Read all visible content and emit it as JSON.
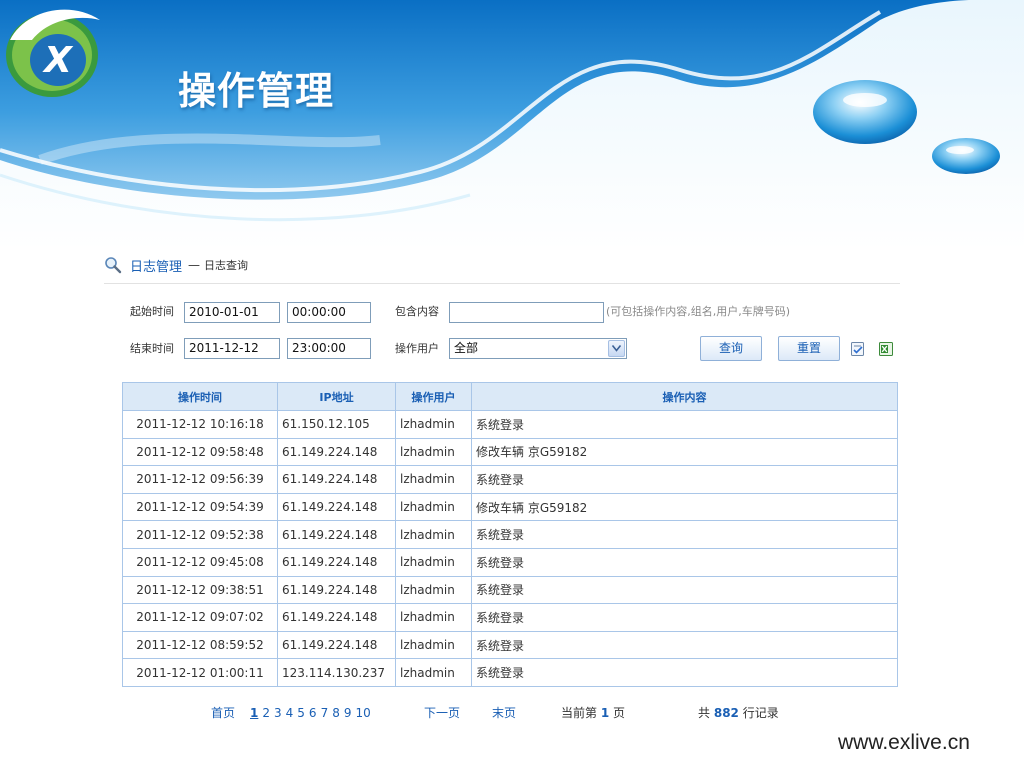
{
  "banner": {
    "title": "操作管理"
  },
  "breadcrumb": {
    "main": "日志管理",
    "separator": "—",
    "sub": "日志查询"
  },
  "filters": {
    "start_label": "起始时间",
    "start_date": "2010-01-01",
    "start_time": "00:00:00",
    "end_label": "结束时间",
    "end_date": "2011-12-12",
    "end_time": "23:00:00",
    "content_label": "包含内容",
    "content_value": "",
    "content_hint": "(可包括操作内容,组名,用户,车牌号码)",
    "user_label": "操作用户",
    "user_selected": "全部",
    "query_button": "查询",
    "reset_button": "重置"
  },
  "table": {
    "columns": [
      "操作时间",
      "IP地址",
      "操作用户",
      "操作内容"
    ],
    "rows": [
      [
        "2011-12-12 10:16:18",
        "61.150.12.105",
        "lzhadmin",
        "系统登录"
      ],
      [
        "2011-12-12 09:58:48",
        "61.149.224.148",
        "lzhadmin",
        "修改车辆 京G59182"
      ],
      [
        "2011-12-12 09:56:39",
        "61.149.224.148",
        "lzhadmin",
        "系统登录"
      ],
      [
        "2011-12-12 09:54:39",
        "61.149.224.148",
        "lzhadmin",
        "修改车辆 京G59182"
      ],
      [
        "2011-12-12 09:52:38",
        "61.149.224.148",
        "lzhadmin",
        "系统登录"
      ],
      [
        "2011-12-12 09:45:08",
        "61.149.224.148",
        "lzhadmin",
        "系统登录"
      ],
      [
        "2011-12-12 09:38:51",
        "61.149.224.148",
        "lzhadmin",
        "系统登录"
      ],
      [
        "2011-12-12 09:07:02",
        "61.149.224.148",
        "lzhadmin",
        "系统登录"
      ],
      [
        "2011-12-12 08:59:52",
        "61.149.224.148",
        "lzhadmin",
        "系统登录"
      ],
      [
        "2011-12-12 01:00:11",
        "123.114.130.237",
        "lzhadmin",
        "系统登录"
      ]
    ]
  },
  "pagination": {
    "first": "首页",
    "pages": [
      "1",
      "2",
      "3",
      "4",
      "5",
      "6",
      "7",
      "8",
      "9",
      "10"
    ],
    "current_page_index": 0,
    "next": "下一页",
    "last": "末页",
    "current_prefix": "当前第",
    "current_value": "1",
    "current_suffix": "页",
    "total_prefix": "共",
    "total_value": "882",
    "total_suffix": "行记录"
  },
  "icons": {
    "breadcrumb": "search-icon",
    "select_arrow": "chevron-down-icon",
    "print": "print-icon",
    "excel": "excel-export-icon"
  },
  "colors": {
    "accent": "#1a5fb4",
    "table_header_bg": "#dbe9f7",
    "table_border": "#a9c6e8"
  },
  "watermark": "www.exlive.cn"
}
